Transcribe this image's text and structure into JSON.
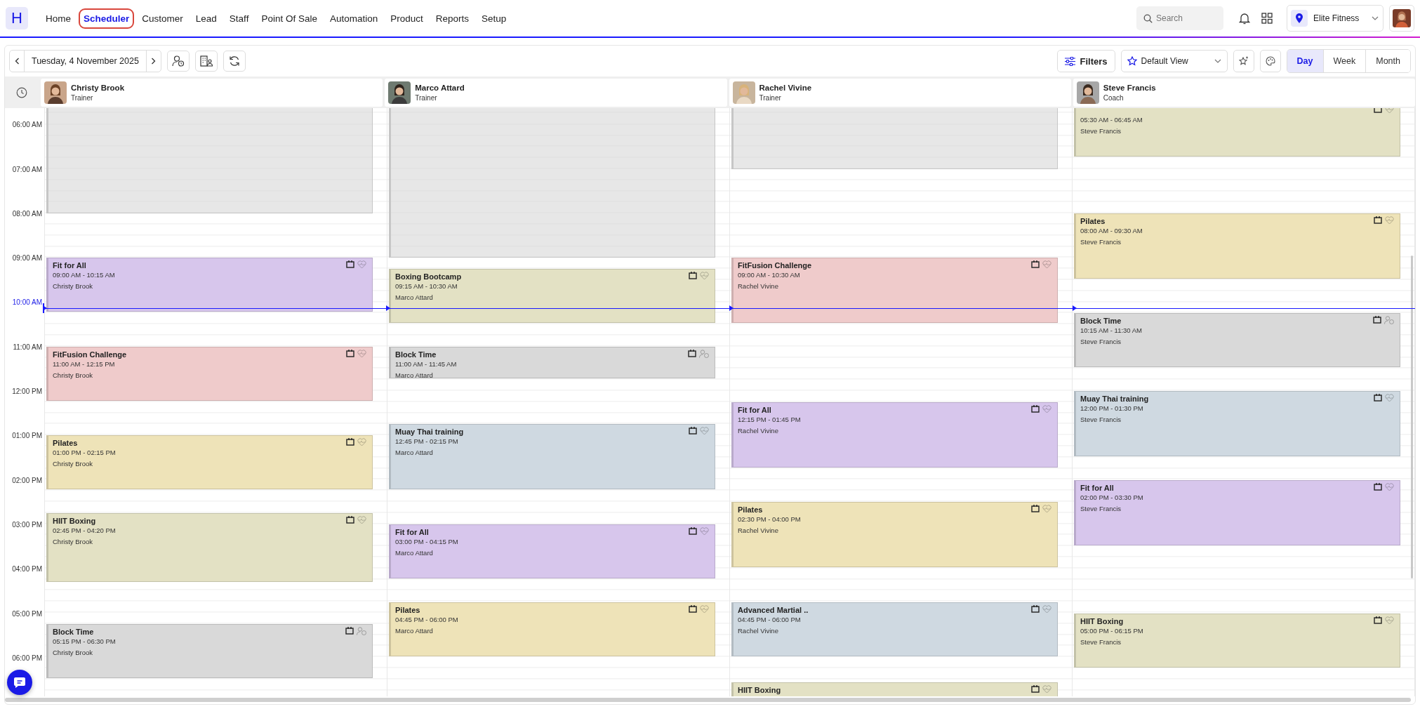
{
  "nav": {
    "logo": "H",
    "items": [
      {
        "label": "Home",
        "selected": false
      },
      {
        "label": "Scheduler",
        "selected": true
      },
      {
        "label": "Customer",
        "selected": false
      },
      {
        "label": "Lead",
        "selected": false
      },
      {
        "label": "Staff",
        "selected": false
      },
      {
        "label": "Point Of Sale",
        "selected": false
      },
      {
        "label": "Automation",
        "selected": false
      },
      {
        "label": "Product",
        "selected": false
      },
      {
        "label": "Reports",
        "selected": false
      },
      {
        "label": "Setup",
        "selected": false
      }
    ],
    "search": {
      "placeholder": "Search"
    },
    "location": "Elite Fitness"
  },
  "toolbar": {
    "date": "Tuesday, 4 November 2025",
    "filters": "Filters",
    "view": "Default View",
    "ranges": [
      {
        "label": "Day",
        "selected": true
      },
      {
        "label": "Week",
        "selected": false
      },
      {
        "label": "Month",
        "selected": false
      }
    ]
  },
  "times": [
    {
      "label": "06:00 AM",
      "current": false
    },
    {
      "label": "07:00 AM",
      "current": false
    },
    {
      "label": "08:00 AM",
      "current": false
    },
    {
      "label": "09:00 AM",
      "current": false
    },
    {
      "label": "10:00 AM",
      "current": true
    },
    {
      "label": "11:00 AM",
      "current": false
    },
    {
      "label": "12:00 PM",
      "current": false
    },
    {
      "label": "01:00 PM",
      "current": false
    },
    {
      "label": "02:00 PM",
      "current": false
    },
    {
      "label": "03:00 PM",
      "current": false
    },
    {
      "label": "04:00 PM",
      "current": false
    },
    {
      "label": "05:00 PM",
      "current": false
    },
    {
      "label": "06:00 PM",
      "current": false
    }
  ],
  "staff": [
    {
      "name": "Christy Brook",
      "role": "Trainer",
      "events": [
        {
          "kind": "class",
          "title": "Fit for All",
          "time": "09:00 AM - 10:15 AM",
          "host": "Christy Brook",
          "color": "#d7c6ec"
        },
        {
          "kind": "class",
          "title": "FitFusion Challenge",
          "time": "11:00 AM - 12:15 PM",
          "host": "Christy Brook",
          "color": "#efcbcb"
        },
        {
          "kind": "class",
          "title": "Pilates",
          "time": "01:00 PM - 02:15 PM",
          "host": "Christy Brook",
          "color": "#eee3b8"
        },
        {
          "kind": "class",
          "title": "HIIT Boxing",
          "time": "02:45 PM - 04:20 PM",
          "host": "Christy Brook",
          "color": "#e3e1c4"
        },
        {
          "kind": "block",
          "title": "Block Time",
          "time": "05:15 PM - 06:30 PM",
          "host": "Christy Brook",
          "color": "#d9d9d9"
        }
      ]
    },
    {
      "name": "Marco Attard",
      "role": "Trainer",
      "events": [
        {
          "kind": "class",
          "title": "Boxing Bootcamp",
          "time": "09:15 AM - 10:30 AM",
          "host": "Marco Attard",
          "color": "#e3e1c4"
        },
        {
          "kind": "block",
          "title": "Block Time",
          "time": "11:00 AM - 11:45 AM",
          "host": "Marco Attard",
          "color": "#d9d9d9"
        },
        {
          "kind": "class",
          "title": "Muay Thai training",
          "time": "12:45 PM - 02:15 PM",
          "host": "Marco Attard",
          "color": "#cfd9e1"
        },
        {
          "kind": "class",
          "title": "Fit for All",
          "time": "03:00 PM - 04:15 PM",
          "host": "Marco Attard",
          "color": "#d7c6ec"
        },
        {
          "kind": "class",
          "title": "Pilates",
          "time": "04:45 PM - 06:00 PM",
          "host": "Marco Attard",
          "color": "#eee3b8"
        }
      ]
    },
    {
      "name": "Rachel Vivine",
      "role": "Trainer",
      "events": [
        {
          "kind": "class",
          "title": "FitFusion Challenge",
          "time": "09:00 AM - 10:30 AM",
          "host": "Rachel Vivine",
          "color": "#efcbcb"
        },
        {
          "kind": "class",
          "title": "Fit for All",
          "time": "12:15 PM - 01:45 PM",
          "host": "Rachel Vivine",
          "color": "#d7c6ec"
        },
        {
          "kind": "class",
          "title": "Pilates",
          "time": "02:30 PM - 04:00 PM",
          "host": "Rachel Vivine",
          "color": "#eee3b8"
        },
        {
          "kind": "class",
          "title": "Advanced Martial ..",
          "time": "04:45 PM - 06:00 PM",
          "host": "Rachel Vivine",
          "color": "#cfd9e1"
        },
        {
          "kind": "class",
          "title": "HIIT Boxing",
          "color": "#e3e1c4"
        }
      ]
    },
    {
      "name": "Steve Francis",
      "role": "Coach",
      "events": [
        {
          "kind": "class",
          "time": "05:30 AM - 06:45 AM",
          "host": "Steve Francis",
          "color": "#e3e1c4"
        },
        {
          "kind": "class",
          "title": "Pilates",
          "time": "08:00 AM - 09:30 AM",
          "host": "Steve Francis",
          "color": "#eee3b8"
        },
        {
          "kind": "block",
          "title": "Block Time",
          "time": "10:15 AM - 11:30 AM",
          "host": "Steve Francis",
          "color": "#d9d9d9"
        },
        {
          "kind": "class",
          "title": "Muay Thai training",
          "time": "12:00 PM - 01:30 PM",
          "host": "Steve Francis",
          "color": "#cfd9e1"
        },
        {
          "kind": "class",
          "title": "Fit for All",
          "time": "02:00 PM - 03:30 PM",
          "host": "Steve Francis",
          "color": "#d7c6ec"
        },
        {
          "kind": "class",
          "title": "HIIT Boxing",
          "time": "05:00 PM - 06:15 PM",
          "host": "Steve Francis",
          "color": "#e3e1c4"
        }
      ]
    }
  ]
}
